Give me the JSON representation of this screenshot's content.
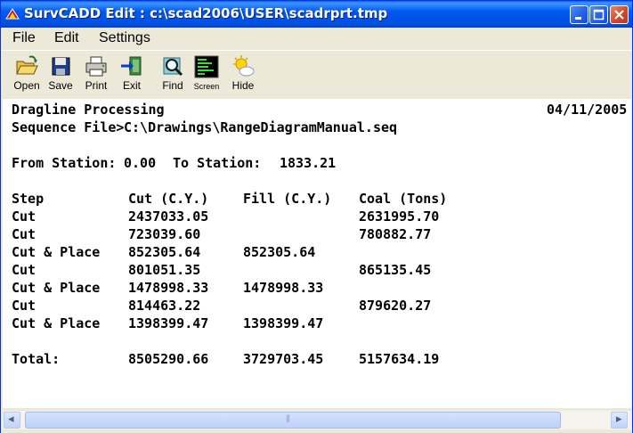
{
  "window": {
    "title": "SurvCADD Edit : c:\\scad2006\\USER\\scadrprt.tmp"
  },
  "menu": {
    "file": "File",
    "edit": "Edit",
    "settings": "Settings"
  },
  "toolbar": {
    "open": "Open",
    "save": "Save",
    "print": "Print",
    "exit": "Exit",
    "find": "Find",
    "screen": "Screen",
    "hide": "Hide"
  },
  "report": {
    "header": "Dragline Processing",
    "date": "04/11/2005",
    "sequence_label": "Sequence File>",
    "sequence_path": "C:\\Drawings\\RangeDiagramManual.seq",
    "from_label": "From Station:",
    "from_value": "0.00",
    "to_label": "To Station:",
    "to_value": "1833.21",
    "columns": [
      "Step",
      "Cut (C.Y.)",
      "Fill (C.Y.)",
      "Coal (Tons)"
    ],
    "rows": [
      [
        "Cut",
        "2437033.05",
        "",
        "2631995.70"
      ],
      [
        "Cut",
        "723039.60",
        "",
        "780882.77"
      ],
      [
        "Cut & Place",
        "852305.64",
        "852305.64",
        ""
      ],
      [
        "Cut",
        "801051.35",
        "",
        "865135.45"
      ],
      [
        "Cut & Place",
        "1478998.33",
        "1478998.33",
        ""
      ],
      [
        "Cut",
        "814463.22",
        "",
        "879620.27"
      ],
      [
        "Cut & Place",
        "1398399.47",
        "1398399.47",
        ""
      ]
    ],
    "total": [
      "Total:",
      "8505290.66",
      "3729703.45",
      "5157634.19"
    ]
  },
  "scrollbar": {
    "left_arrow": "◂",
    "right_arrow": "▸",
    "grip": "⦀"
  }
}
